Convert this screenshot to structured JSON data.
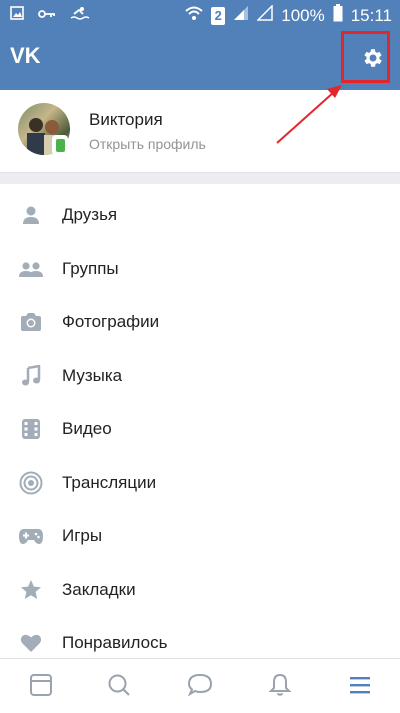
{
  "status_bar": {
    "battery": "100%",
    "time": "15:11",
    "sim": "2"
  },
  "app": {
    "logo": "vk-logo",
    "settings_icon": "gear-icon"
  },
  "profile": {
    "name": "Виктория",
    "subtitle": "Открыть профиль"
  },
  "menu": [
    {
      "label": "Друзья",
      "icon": "person-icon"
    },
    {
      "label": "Группы",
      "icon": "group-icon"
    },
    {
      "label": "Фотографии",
      "icon": "camera-icon"
    },
    {
      "label": "Музыка",
      "icon": "music-note-icon"
    },
    {
      "label": "Видео",
      "icon": "film-icon"
    },
    {
      "label": "Трансляции",
      "icon": "broadcast-icon"
    },
    {
      "label": "Игры",
      "icon": "gamepad-icon"
    },
    {
      "label": "Закладки",
      "icon": "star-icon"
    },
    {
      "label": "Понравилось",
      "icon": "heart-icon"
    }
  ],
  "bottom_nav": [
    "news-icon",
    "search-icon",
    "messages-icon",
    "notifications-icon",
    "menu-icon"
  ],
  "colors": {
    "header": "#5181b8",
    "icon_gray": "#a3adb8",
    "accent": "#5181b8",
    "highlight": "#e3262c",
    "online": "#4bb34b"
  }
}
